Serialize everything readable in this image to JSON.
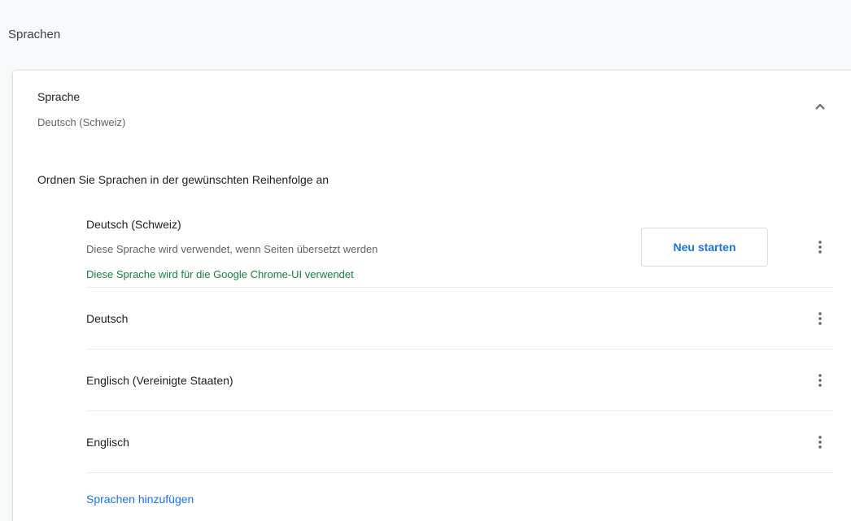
{
  "section": {
    "title": "Sprachen"
  },
  "language_setting": {
    "label": "Sprache",
    "current_value": "Deutsch (Schweiz)",
    "expanded": true,
    "collapse_icon": "chevron-up-icon"
  },
  "order_hint": "Ordnen Sie Sprachen in der gewünschten Reihenfolge an",
  "languages": [
    {
      "name": "Deutsch (Schweiz)",
      "subtitle": "Diese Sprache wird verwendet, wenn Seiten übersetzt werden",
      "ui_note": "Diese Sprache wird für die Google Chrome-UI verwendet",
      "restart_label": "Neu starten",
      "menu_icon": "more-vert-icon"
    },
    {
      "name": "Deutsch",
      "menu_icon": "more-vert-icon"
    },
    {
      "name": "Englisch (Vereinigte Staaten)",
      "menu_icon": "more-vert-icon"
    },
    {
      "name": "Englisch",
      "menu_icon": "more-vert-icon"
    }
  ],
  "add_languages_label": "Sprachen hinzufügen",
  "colors": {
    "accent_blue": "#1a73e8",
    "ui_note_green": "#188038",
    "secondary_text": "#5f6368",
    "divider": "#e8eaed"
  }
}
